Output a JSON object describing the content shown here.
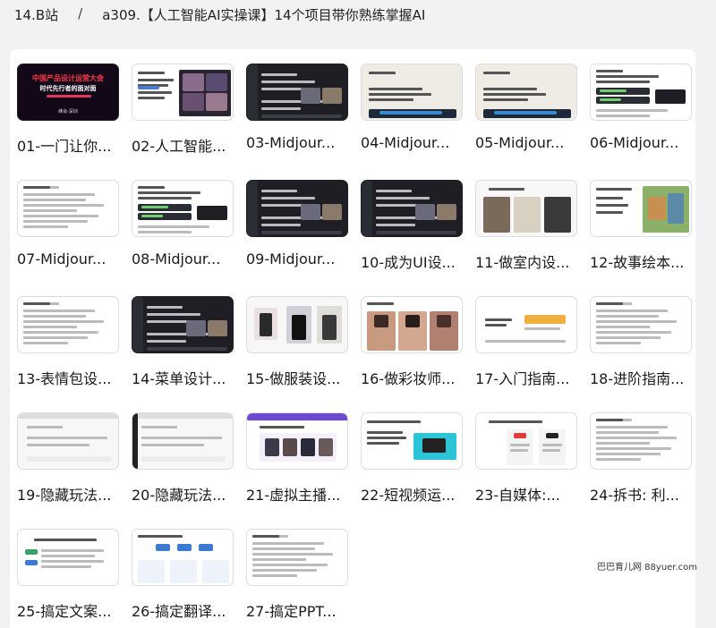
{
  "breadcrumb": {
    "root": "14.B站",
    "separator": "/",
    "current": "a309.【人工智能AI实操课】14个项目带你熟练掌握AI"
  },
  "files": [
    {
      "label": "01-一门让你...",
      "thumb": "poster"
    },
    {
      "label": "02-人工智能...",
      "thumb": "doc-images"
    },
    {
      "label": "03-Midjour...",
      "thumb": "dark-ui"
    },
    {
      "label": "04-Midjour...",
      "thumb": "beige-doc"
    },
    {
      "label": "05-Midjour...",
      "thumb": "beige-doc"
    },
    {
      "label": "06-Midjour...",
      "thumb": "code-doc"
    },
    {
      "label": "07-Midjour...",
      "thumb": "doc"
    },
    {
      "label": "08-Midjour...",
      "thumb": "code-doc"
    },
    {
      "label": "09-Midjour...",
      "thumb": "dark-ui"
    },
    {
      "label": "10-成为UI设...",
      "thumb": "dark-ui"
    },
    {
      "label": "11-做室内设...",
      "thumb": "interior"
    },
    {
      "label": "12-故事绘本...",
      "thumb": "storybook"
    },
    {
      "label": "13-表情包设...",
      "thumb": "doc"
    },
    {
      "label": "14-菜单设计...",
      "thumb": "dark-ui"
    },
    {
      "label": "15-做服装设...",
      "thumb": "fashion"
    },
    {
      "label": "16-做彩妆师...",
      "thumb": "faces"
    },
    {
      "label": "17-入门指南...",
      "thumb": "slide"
    },
    {
      "label": "18-进阶指南...",
      "thumb": "doc"
    },
    {
      "label": "19-隐藏玩法...",
      "thumb": "light-app"
    },
    {
      "label": "20-隐藏玩法...",
      "thumb": "light-app"
    },
    {
      "label": "21-虚拟主播...",
      "thumb": "purple-app"
    },
    {
      "label": "22-短视频运...",
      "thumb": "video-slide"
    },
    {
      "label": "23-自媒体:...",
      "thumb": "social-slide"
    },
    {
      "label": "24-拆书: 利...",
      "thumb": "doc"
    },
    {
      "label": "25-搞定文案...",
      "thumb": "text-slide"
    },
    {
      "label": "26-搞定翻译...",
      "thumb": "flow-slide"
    },
    {
      "label": "27-搞定PPT...",
      "thumb": "doc"
    }
  ],
  "poster": {
    "title": "中国产品设计运营大会",
    "subtitle": "时代先行者的面对面",
    "footer": "峰会·深圳"
  },
  "watermark": "巴巴育儿网 88yuer.com"
}
